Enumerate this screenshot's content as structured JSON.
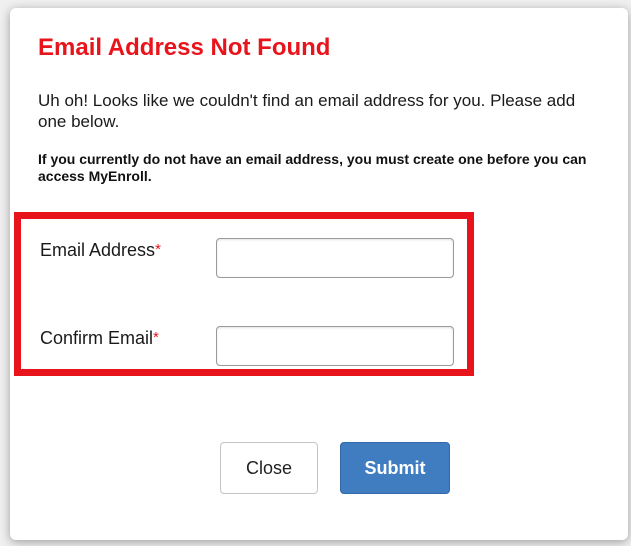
{
  "dialog": {
    "title": "Email Address Not Found",
    "message": "Uh oh! Looks like we couldn't find an email address for you. Please add one below.",
    "note": "If you currently do not have an email address, you must create one before you can access MyEnroll."
  },
  "form": {
    "email_label": "Email Address",
    "confirm_label": "Confirm Email",
    "required_marker": "*",
    "email_value": "",
    "confirm_value": ""
  },
  "buttons": {
    "close_label": "Close",
    "submit_label": "Submit"
  },
  "colors": {
    "title": "#e8141c",
    "highlight_border": "#e8141c",
    "submit_bg": "#3f7cc0"
  }
}
